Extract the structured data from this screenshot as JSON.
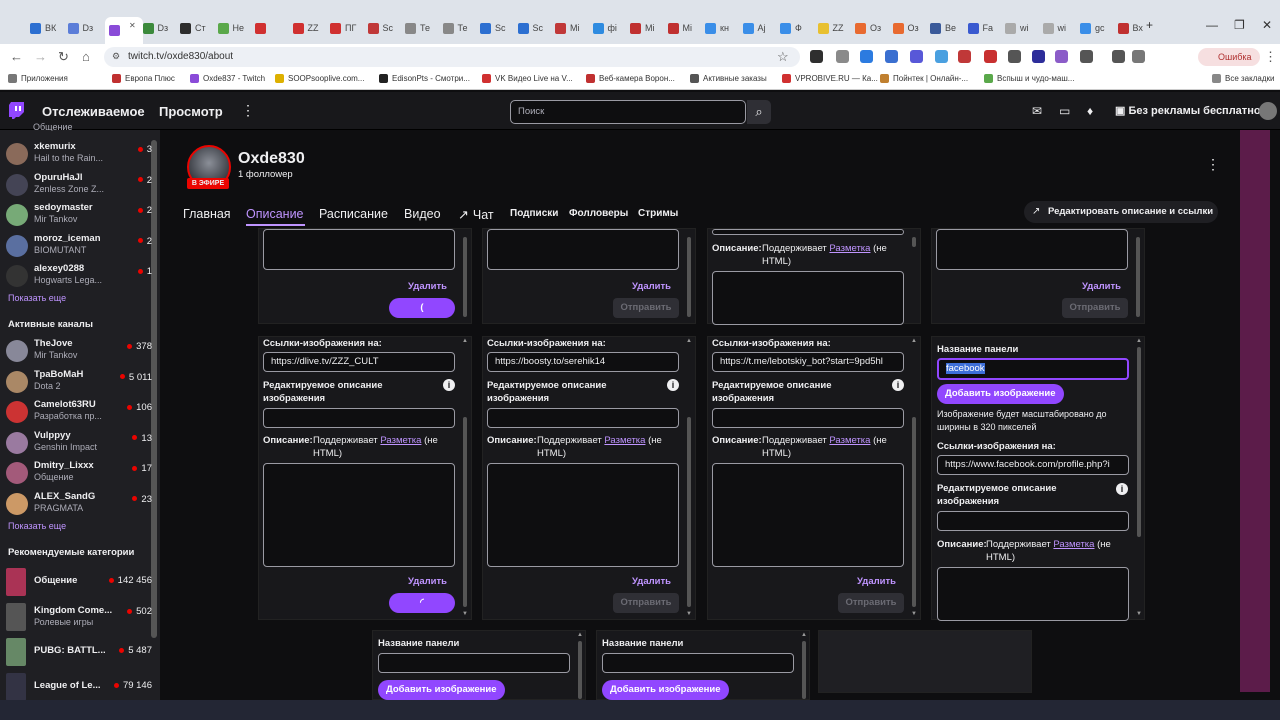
{
  "browser": {
    "tabs": [
      "ВК",
      "Dз",
      "",
      "Dз",
      "Ст",
      "Не",
      "",
      "ZZ",
      "ПГ",
      "Sc",
      "Те",
      "Те",
      "Sc",
      "Sc",
      "Мі",
      "фі",
      "Мі",
      "Мі",
      "кн",
      "Аj",
      "Ф",
      "ZZ",
      "Оз",
      "Оз",
      "Ве",
      "Fa",
      "wi",
      "wi",
      "gc",
      "Вх"
    ],
    "url": "twitch.tv/oxde830/about",
    "error_label": "Ошибка",
    "bookmarks": [
      "Приложения",
      "Европа Плюс",
      "Oxde837 - Twitch",
      "SOOPsooplive.com...",
      "EdisonPts - Смотри...",
      "VK Видео Live на V...",
      "Веб-камера Ворон...",
      "Активные заказы",
      "VPROBIVE.RU — Ка...",
      "Пойнтек | Онлайн-...",
      "Вспыш и чудо-маш..."
    ],
    "all_bookmarks": "Все закладки"
  },
  "twitch": {
    "following": "Отслеживаемое",
    "browse": "Просмотр",
    "search_placeholder": "Поиск",
    "turbo": "Без рекламы бесплатно"
  },
  "sidebar": {
    "top_partial": "Общение",
    "followed": [
      {
        "name": "xkemurix",
        "game": "Hail to the Rain...",
        "viewers": "3"
      },
      {
        "name": "OpuruHaJl",
        "game": "Zenless Zone Z...",
        "viewers": "2"
      },
      {
        "name": "sedoymaster",
        "game": "Mir Tankov",
        "viewers": "2"
      },
      {
        "name": "moroz_iceman",
        "game": "BIOMUTANT",
        "viewers": "2"
      },
      {
        "name": "alexey0288",
        "game": "Hogwarts Lega...",
        "viewers": "1"
      }
    ],
    "show_more": "Показать еще",
    "active_title": "Активные каналы",
    "active": [
      {
        "name": "TheJove",
        "game": "Mir Tankov",
        "viewers": "378"
      },
      {
        "name": "ТраВоМаН",
        "game": "Dota 2",
        "viewers": "5 011"
      },
      {
        "name": "Camelot63RU",
        "game": "Разработка пр...",
        "viewers": "106"
      },
      {
        "name": "Vulppyy",
        "game": "Genshin Impact",
        "viewers": "13"
      },
      {
        "name": "Dmitry_Lixxx",
        "game": "Общение",
        "viewers": "17"
      },
      {
        "name": "ALEX_SandG",
        "game": "PRAGMATA",
        "viewers": "23"
      }
    ],
    "show_more2": "Показать еще",
    "rec_title": "Рекомендуемые категории",
    "categories": [
      {
        "name": "Общение",
        "sub": "",
        "viewers": "142 456"
      },
      {
        "name": "Kingdom Come...",
        "sub": "Ролевые игры",
        "viewers": "502"
      },
      {
        "name": "PUBG: BATTL...",
        "sub": "",
        "viewers": "5 487"
      },
      {
        "name": "League of Le...",
        "sub": "",
        "viewers": "79 146"
      }
    ]
  },
  "channel": {
    "name": "Oxde830",
    "followers": "1 фоллоwер",
    "live": "В ЭФИРЕ",
    "tabs": [
      "Главная",
      "Описание",
      "Расписание",
      "Видео",
      "Чат",
      "Подписки",
      "Фолловеры",
      "Стримы"
    ],
    "edit_button": "Редактировать описание и ссылки"
  },
  "panels": {
    "delete": "Удалить",
    "send": "Отправить",
    "desc_label": "Описание:",
    "desc_support": "Поддерживает",
    "markup": "Разметка",
    "no_html": "(не",
    "html": "HTML)",
    "link_label": "Ссылки-изображения на:",
    "alt_label": "Редактируемое описание",
    "alt_label2": "изображения",
    "panel_name": "Название панели",
    "add_image": "Добавить изображение",
    "scale_note": "Изображение будет масштабировано до",
    "scale_note2": "ширины в 320 пикселей",
    "row2": [
      {
        "link": "https://dlive.tv/ZZZ_CULT"
      },
      {
        "link": "https://boosty.to/serehik14"
      },
      {
        "link": "https://t.me/lebotskiy_bot?start=9pd5hl"
      }
    ],
    "fb_name": "facebook",
    "fb_link": "https://www.facebook.com/profile.php?i"
  }
}
